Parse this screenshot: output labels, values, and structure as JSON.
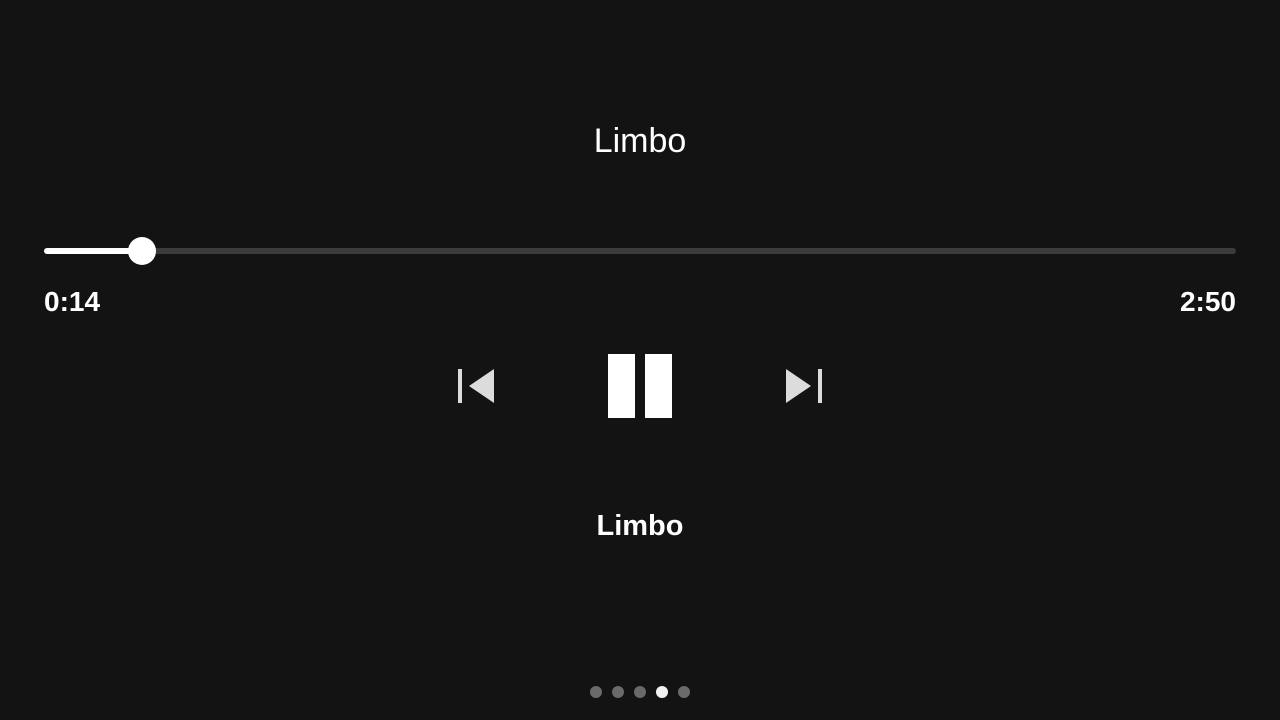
{
  "player": {
    "title": "Limbo",
    "subtitle": "Limbo",
    "elapsed": "0:14",
    "duration": "2:50",
    "progress_fraction": 0.0824,
    "state": "playing"
  },
  "controls": {
    "previous_icon": "skip-previous-icon",
    "pause_icon": "pause-icon",
    "next_icon": "skip-next-icon"
  },
  "pager": {
    "count": 5,
    "active_index": 3
  },
  "colors": {
    "background": "#131313",
    "foreground": "#ffffff",
    "track_rail": "#3b3b3b",
    "icon_gray": "#dcdcdc",
    "dot_inactive": "#6a6a6a",
    "dot_active": "#f2f2f2"
  }
}
